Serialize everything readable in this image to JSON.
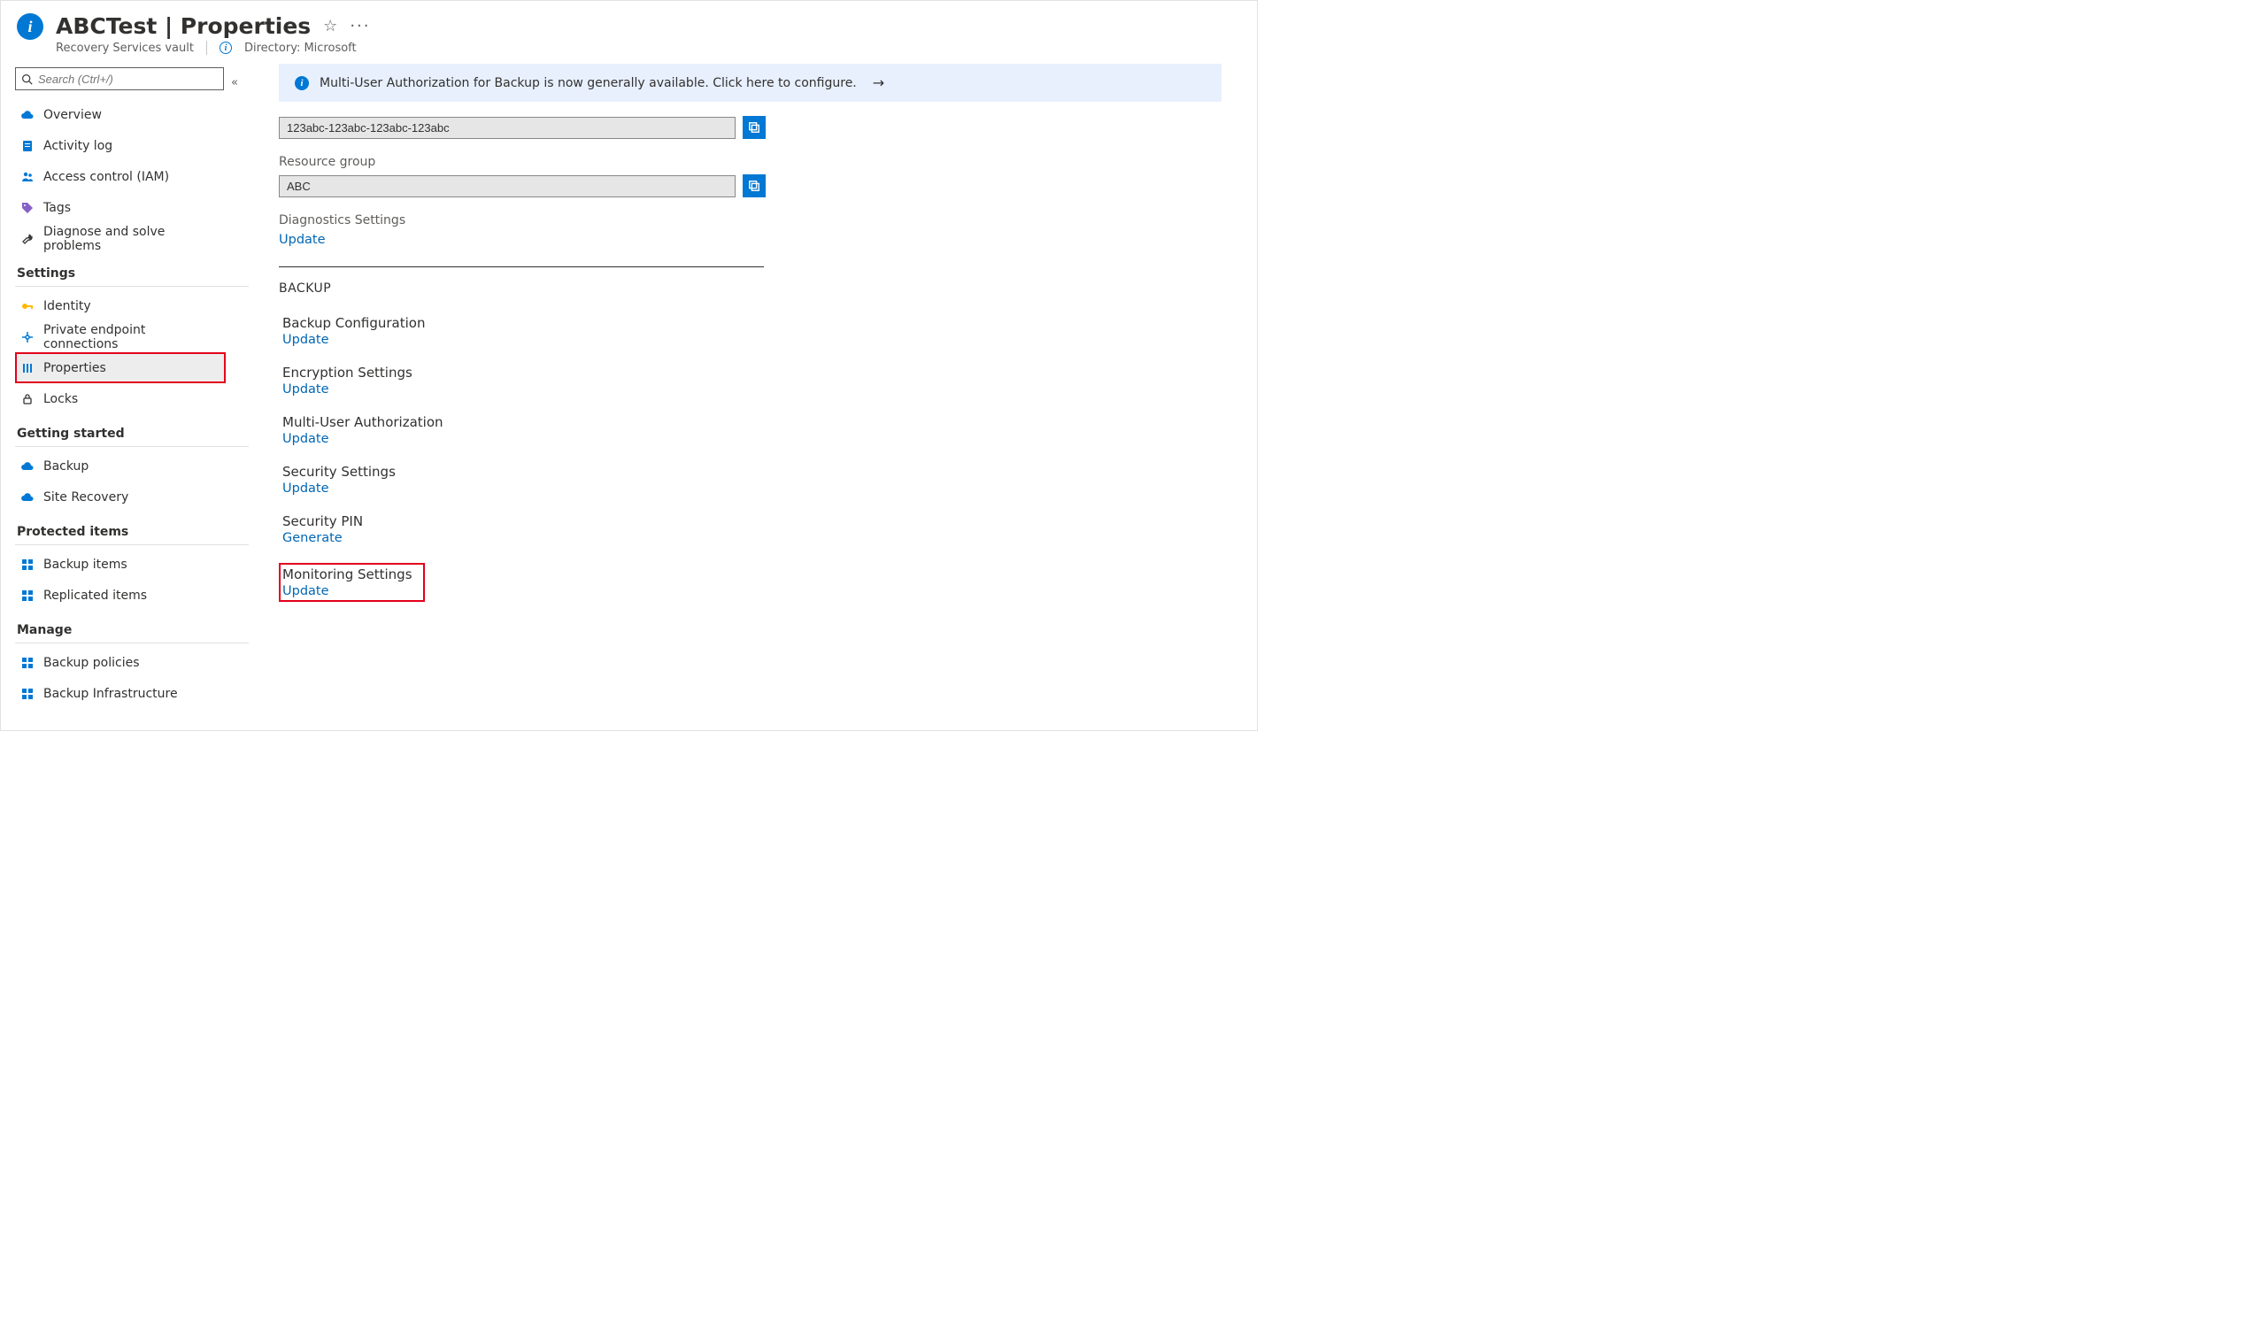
{
  "header": {
    "title": "ABCTest | Properties",
    "subtitle": "Recovery Services vault",
    "directory_label": "Directory: Microsoft"
  },
  "search": {
    "placeholder": "Search (Ctrl+/)"
  },
  "nav": {
    "top": [
      {
        "id": "overview",
        "label": "Overview",
        "icon": "cloud-blue"
      },
      {
        "id": "activity-log",
        "label": "Activity log",
        "icon": "log-blue"
      },
      {
        "id": "access-control",
        "label": "Access control (IAM)",
        "icon": "people-blue"
      },
      {
        "id": "tags",
        "label": "Tags",
        "icon": "tag-purple"
      },
      {
        "id": "diagnose",
        "label": "Diagnose and solve problems",
        "icon": "wrench"
      }
    ],
    "section_settings": "Settings",
    "settings": [
      {
        "id": "identity",
        "label": "Identity",
        "icon": "key-yellow"
      },
      {
        "id": "private-endpoint",
        "label": "Private endpoint connections",
        "icon": "endpoint-blue"
      },
      {
        "id": "properties",
        "label": "Properties",
        "icon": "sliders-blue",
        "selected": true,
        "hl": true
      },
      {
        "id": "locks",
        "label": "Locks",
        "icon": "lock"
      }
    ],
    "section_getting_started": "Getting started",
    "getting_started": [
      {
        "id": "backup",
        "label": "Backup",
        "icon": "cloud-blue"
      },
      {
        "id": "site-recovery",
        "label": "Site Recovery",
        "icon": "cloud-blue"
      }
    ],
    "section_protected": "Protected items",
    "protected": [
      {
        "id": "backup-items",
        "label": "Backup items",
        "icon": "grid-blue"
      },
      {
        "id": "replicated-items",
        "label": "Replicated items",
        "icon": "grid-blue"
      }
    ],
    "section_manage": "Manage",
    "manage": [
      {
        "id": "backup-policies",
        "label": "Backup policies",
        "icon": "grid-blue"
      },
      {
        "id": "backup-infra",
        "label": "Backup Infrastructure",
        "icon": "grid-blue"
      }
    ]
  },
  "banner": {
    "text": "Multi-User Authorization for Backup is now generally available. Click here to configure."
  },
  "fields": {
    "id_value": "123abc-123abc-123abc-123abc",
    "resource_group_label": "Resource group",
    "resource_group_value": "ABC",
    "diagnostics_label": "Diagnostics Settings",
    "diagnostics_link": "Update"
  },
  "backup_section": {
    "heading": "BACKUP",
    "items": [
      {
        "title": "Backup Configuration",
        "link": "Update"
      },
      {
        "title": "Encryption Settings",
        "link": "Update"
      },
      {
        "title": "Multi-User Authorization",
        "link": "Update"
      },
      {
        "title": "Security Settings",
        "link": "Update"
      },
      {
        "title": "Security PIN",
        "link": "Generate"
      },
      {
        "title": "Monitoring Settings",
        "link": "Update",
        "hl": true
      }
    ]
  }
}
